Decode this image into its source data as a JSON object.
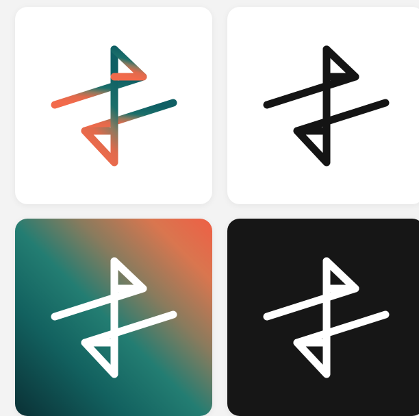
{
  "logo_variants": [
    {
      "name": "gradient-mark-on-white",
      "background": "#ffffff",
      "mark_colors": [
        "#0f5f64",
        "#f26a4b"
      ]
    },
    {
      "name": "black-mark-on-white",
      "background": "#ffffff",
      "mark_color": "#141414"
    },
    {
      "name": "white-mark-on-gradient",
      "background_colors": [
        "#ee5f45",
        "#1e7d73",
        "#0a3035"
      ],
      "mark_color": "#ffffff"
    },
    {
      "name": "white-mark-on-black",
      "background": "#161616",
      "mark_color": "#ffffff"
    }
  ]
}
